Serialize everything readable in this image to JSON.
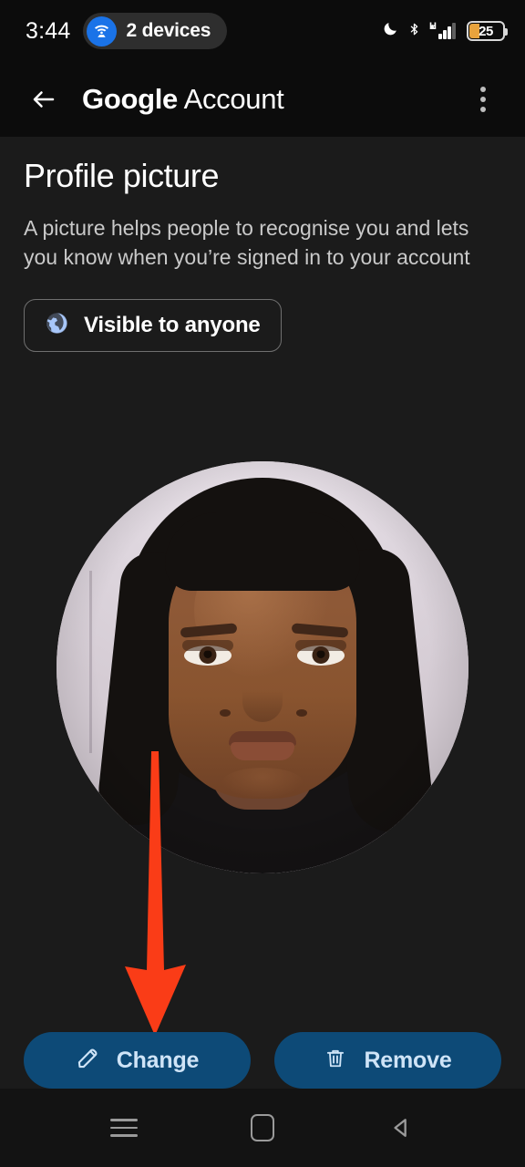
{
  "status_bar": {
    "time": "3:44",
    "cast_chip": {
      "icon": "cast-devices-icon",
      "label": "2 devices",
      "circle_color": "#1a73e8",
      "pill_color": "#2e2e2e"
    },
    "icons": [
      {
        "name": "do-not-disturb-moon-icon",
        "glyph": "moon"
      },
      {
        "name": "bluetooth-icon",
        "glyph": "bluetooth"
      },
      {
        "name": "mobile-signal-icon",
        "network": "H"
      }
    ],
    "battery": {
      "level_text": "25",
      "fill_color": "#e8a33d"
    }
  },
  "app_bar": {
    "back_icon": "back-arrow-icon",
    "title_brand": "Google",
    "title_rest": " Account",
    "overflow_icon": "overflow-menu-icon"
  },
  "main": {
    "page_title": "Profile picture",
    "description": "A picture helps people to recognise you and lets you know when you’re signed in to your account",
    "visibility_chip": {
      "icon": "globe-icon",
      "label": "Visible to anyone",
      "icon_color": "#a8c7fa"
    },
    "avatar": {
      "name": "profile-picture-avatar",
      "alt": "Profile photo of a woman with braided hair"
    }
  },
  "annotation": {
    "name": "red-arrow-pointing-to-change-button",
    "color": "#fa3c17",
    "points_to": "Change"
  },
  "actions": [
    {
      "name": "change-button",
      "icon": "pencil-icon",
      "label": "Change",
      "bg": "#0d4a77",
      "fg": "#cfe4f7"
    },
    {
      "name": "remove-button",
      "icon": "trash-icon",
      "label": "Remove",
      "bg": "#0d4a77",
      "fg": "#cfe4f7"
    }
  ],
  "nav_bar": {
    "recents": "recents-icon",
    "home": "home-icon",
    "back": "back-nav-icon"
  }
}
